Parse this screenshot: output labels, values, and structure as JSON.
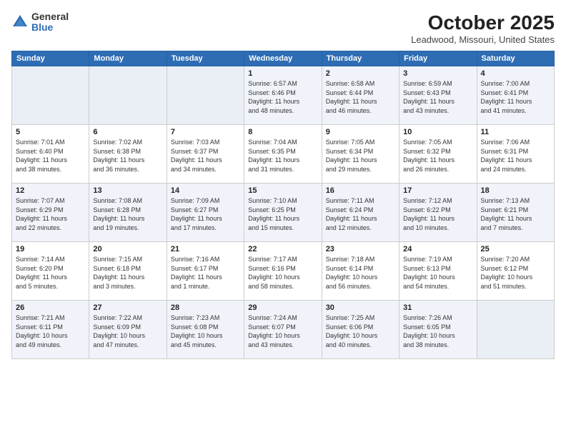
{
  "logo": {
    "general": "General",
    "blue": "Blue"
  },
  "header": {
    "title": "October 2025",
    "subtitle": "Leadwood, Missouri, United States"
  },
  "weekdays": [
    "Sunday",
    "Monday",
    "Tuesday",
    "Wednesday",
    "Thursday",
    "Friday",
    "Saturday"
  ],
  "weeks": [
    [
      {
        "day": "",
        "info": ""
      },
      {
        "day": "",
        "info": ""
      },
      {
        "day": "",
        "info": ""
      },
      {
        "day": "1",
        "info": "Sunrise: 6:57 AM\nSunset: 6:46 PM\nDaylight: 11 hours\nand 48 minutes."
      },
      {
        "day": "2",
        "info": "Sunrise: 6:58 AM\nSunset: 6:44 PM\nDaylight: 11 hours\nand 46 minutes."
      },
      {
        "day": "3",
        "info": "Sunrise: 6:59 AM\nSunset: 6:43 PM\nDaylight: 11 hours\nand 43 minutes."
      },
      {
        "day": "4",
        "info": "Sunrise: 7:00 AM\nSunset: 6:41 PM\nDaylight: 11 hours\nand 41 minutes."
      }
    ],
    [
      {
        "day": "5",
        "info": "Sunrise: 7:01 AM\nSunset: 6:40 PM\nDaylight: 11 hours\nand 38 minutes."
      },
      {
        "day": "6",
        "info": "Sunrise: 7:02 AM\nSunset: 6:38 PM\nDaylight: 11 hours\nand 36 minutes."
      },
      {
        "day": "7",
        "info": "Sunrise: 7:03 AM\nSunset: 6:37 PM\nDaylight: 11 hours\nand 34 minutes."
      },
      {
        "day": "8",
        "info": "Sunrise: 7:04 AM\nSunset: 6:35 PM\nDaylight: 11 hours\nand 31 minutes."
      },
      {
        "day": "9",
        "info": "Sunrise: 7:05 AM\nSunset: 6:34 PM\nDaylight: 11 hours\nand 29 minutes."
      },
      {
        "day": "10",
        "info": "Sunrise: 7:05 AM\nSunset: 6:32 PM\nDaylight: 11 hours\nand 26 minutes."
      },
      {
        "day": "11",
        "info": "Sunrise: 7:06 AM\nSunset: 6:31 PM\nDaylight: 11 hours\nand 24 minutes."
      }
    ],
    [
      {
        "day": "12",
        "info": "Sunrise: 7:07 AM\nSunset: 6:29 PM\nDaylight: 11 hours\nand 22 minutes."
      },
      {
        "day": "13",
        "info": "Sunrise: 7:08 AM\nSunset: 6:28 PM\nDaylight: 11 hours\nand 19 minutes."
      },
      {
        "day": "14",
        "info": "Sunrise: 7:09 AM\nSunset: 6:27 PM\nDaylight: 11 hours\nand 17 minutes."
      },
      {
        "day": "15",
        "info": "Sunrise: 7:10 AM\nSunset: 6:25 PM\nDaylight: 11 hours\nand 15 minutes."
      },
      {
        "day": "16",
        "info": "Sunrise: 7:11 AM\nSunset: 6:24 PM\nDaylight: 11 hours\nand 12 minutes."
      },
      {
        "day": "17",
        "info": "Sunrise: 7:12 AM\nSunset: 6:22 PM\nDaylight: 11 hours\nand 10 minutes."
      },
      {
        "day": "18",
        "info": "Sunrise: 7:13 AM\nSunset: 6:21 PM\nDaylight: 11 hours\nand 7 minutes."
      }
    ],
    [
      {
        "day": "19",
        "info": "Sunrise: 7:14 AM\nSunset: 6:20 PM\nDaylight: 11 hours\nand 5 minutes."
      },
      {
        "day": "20",
        "info": "Sunrise: 7:15 AM\nSunset: 6:18 PM\nDaylight: 11 hours\nand 3 minutes."
      },
      {
        "day": "21",
        "info": "Sunrise: 7:16 AM\nSunset: 6:17 PM\nDaylight: 11 hours\nand 1 minute."
      },
      {
        "day": "22",
        "info": "Sunrise: 7:17 AM\nSunset: 6:16 PM\nDaylight: 10 hours\nand 58 minutes."
      },
      {
        "day": "23",
        "info": "Sunrise: 7:18 AM\nSunset: 6:14 PM\nDaylight: 10 hours\nand 56 minutes."
      },
      {
        "day": "24",
        "info": "Sunrise: 7:19 AM\nSunset: 6:13 PM\nDaylight: 10 hours\nand 54 minutes."
      },
      {
        "day": "25",
        "info": "Sunrise: 7:20 AM\nSunset: 6:12 PM\nDaylight: 10 hours\nand 51 minutes."
      }
    ],
    [
      {
        "day": "26",
        "info": "Sunrise: 7:21 AM\nSunset: 6:11 PM\nDaylight: 10 hours\nand 49 minutes."
      },
      {
        "day": "27",
        "info": "Sunrise: 7:22 AM\nSunset: 6:09 PM\nDaylight: 10 hours\nand 47 minutes."
      },
      {
        "day": "28",
        "info": "Sunrise: 7:23 AM\nSunset: 6:08 PM\nDaylight: 10 hours\nand 45 minutes."
      },
      {
        "day": "29",
        "info": "Sunrise: 7:24 AM\nSunset: 6:07 PM\nDaylight: 10 hours\nand 43 minutes."
      },
      {
        "day": "30",
        "info": "Sunrise: 7:25 AM\nSunset: 6:06 PM\nDaylight: 10 hours\nand 40 minutes."
      },
      {
        "day": "31",
        "info": "Sunrise: 7:26 AM\nSunset: 6:05 PM\nDaylight: 10 hours\nand 38 minutes."
      },
      {
        "day": "",
        "info": ""
      }
    ]
  ]
}
